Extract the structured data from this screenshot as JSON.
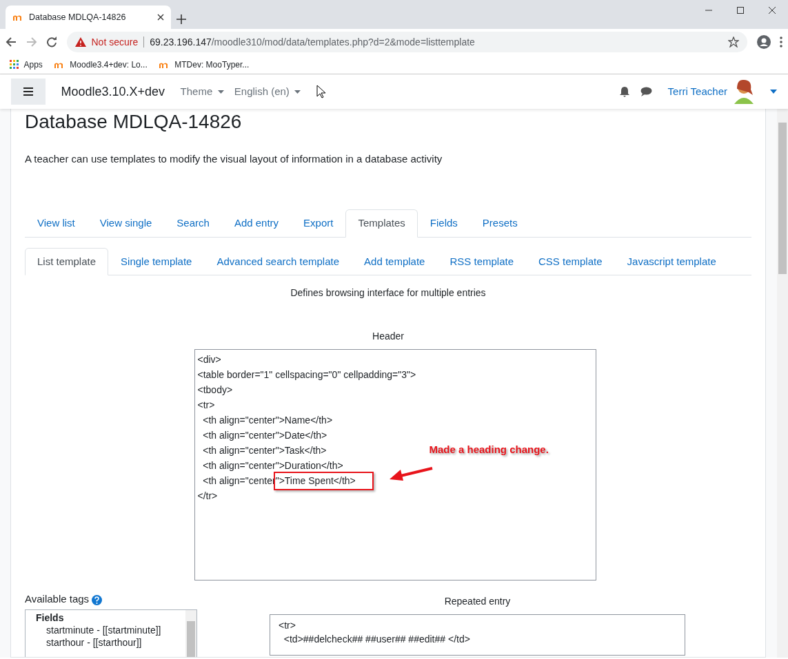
{
  "browser": {
    "tab_title": "Database MDLQA-14826",
    "security": "Not secure",
    "url_host": "69.23.196.147",
    "url_path": "/moodle310/mod/data/templates.php?d=2&mode=listtemplate",
    "bookmarks": [
      {
        "label": "Apps",
        "kind": "apps"
      },
      {
        "label": "Moodle3.4+dev: Lo...",
        "kind": "moodle"
      },
      {
        "label": "MTDev: MooTyper...",
        "kind": "moodle"
      }
    ]
  },
  "navbar": {
    "site_name": "Moodle3.10.X+dev",
    "menus": [
      "Theme",
      "English (en)"
    ],
    "user_name": "Terri Teacher"
  },
  "page": {
    "heading": "Database MDLQA-14826",
    "intro": "A teacher can use templates to modify the visual layout of information in a database activity",
    "tabs": [
      {
        "label": "View list",
        "selected": false
      },
      {
        "label": "View single",
        "selected": false
      },
      {
        "label": "Search",
        "selected": false
      },
      {
        "label": "Add entry",
        "selected": false
      },
      {
        "label": "Export",
        "selected": false
      },
      {
        "label": "Templates",
        "selected": true
      },
      {
        "label": "Fields",
        "selected": false
      },
      {
        "label": "Presets",
        "selected": false
      }
    ],
    "subtabs": [
      {
        "label": "List template",
        "selected": true
      },
      {
        "label": "Single template",
        "selected": false
      },
      {
        "label": "Advanced search template",
        "selected": false
      },
      {
        "label": "Add template",
        "selected": false
      },
      {
        "label": "RSS template",
        "selected": false
      },
      {
        "label": "CSS template",
        "selected": false
      },
      {
        "label": "Javascript template",
        "selected": false
      }
    ],
    "description": "Defines browsing interface for multiple entries",
    "header": {
      "label": "Header",
      "lines": [
        {
          "text": "<div>",
          "highlighted": false
        },
        {
          "text": "<table border=\"1\" cellspacing=\"0\" cellpadding=\"3\">",
          "highlighted": false
        },
        {
          "text": "<tbody>",
          "highlighted": false
        },
        {
          "text": "<tr>",
          "highlighted": false
        },
        {
          "text": "  <th align=\"center\">Name</th>",
          "highlighted": false
        },
        {
          "text": "  <th align=\"center\">Date</th>",
          "highlighted": false
        },
        {
          "text": "  <th align=\"center\">Task</th>",
          "highlighted": false
        },
        {
          "text": "  <th align=\"center\">Duration</th>",
          "highlighted": false
        },
        {
          "text": "  <th align=\"center\">Time Spent</th>",
          "highlighted": true
        },
        {
          "text": "</tr>",
          "highlighted": false
        }
      ],
      "annotation": "Made a heading change."
    },
    "available_tags": {
      "label": "Available tags",
      "group": "Fields",
      "items": [
        "startminute - [[startminute]]",
        "starthour - [[starthour]]"
      ]
    },
    "repeated": {
      "label": "Repeated entry",
      "lines": [
        "<tr>",
        "  <td>##delcheck## ##user## ##edit## </td>"
      ]
    }
  }
}
